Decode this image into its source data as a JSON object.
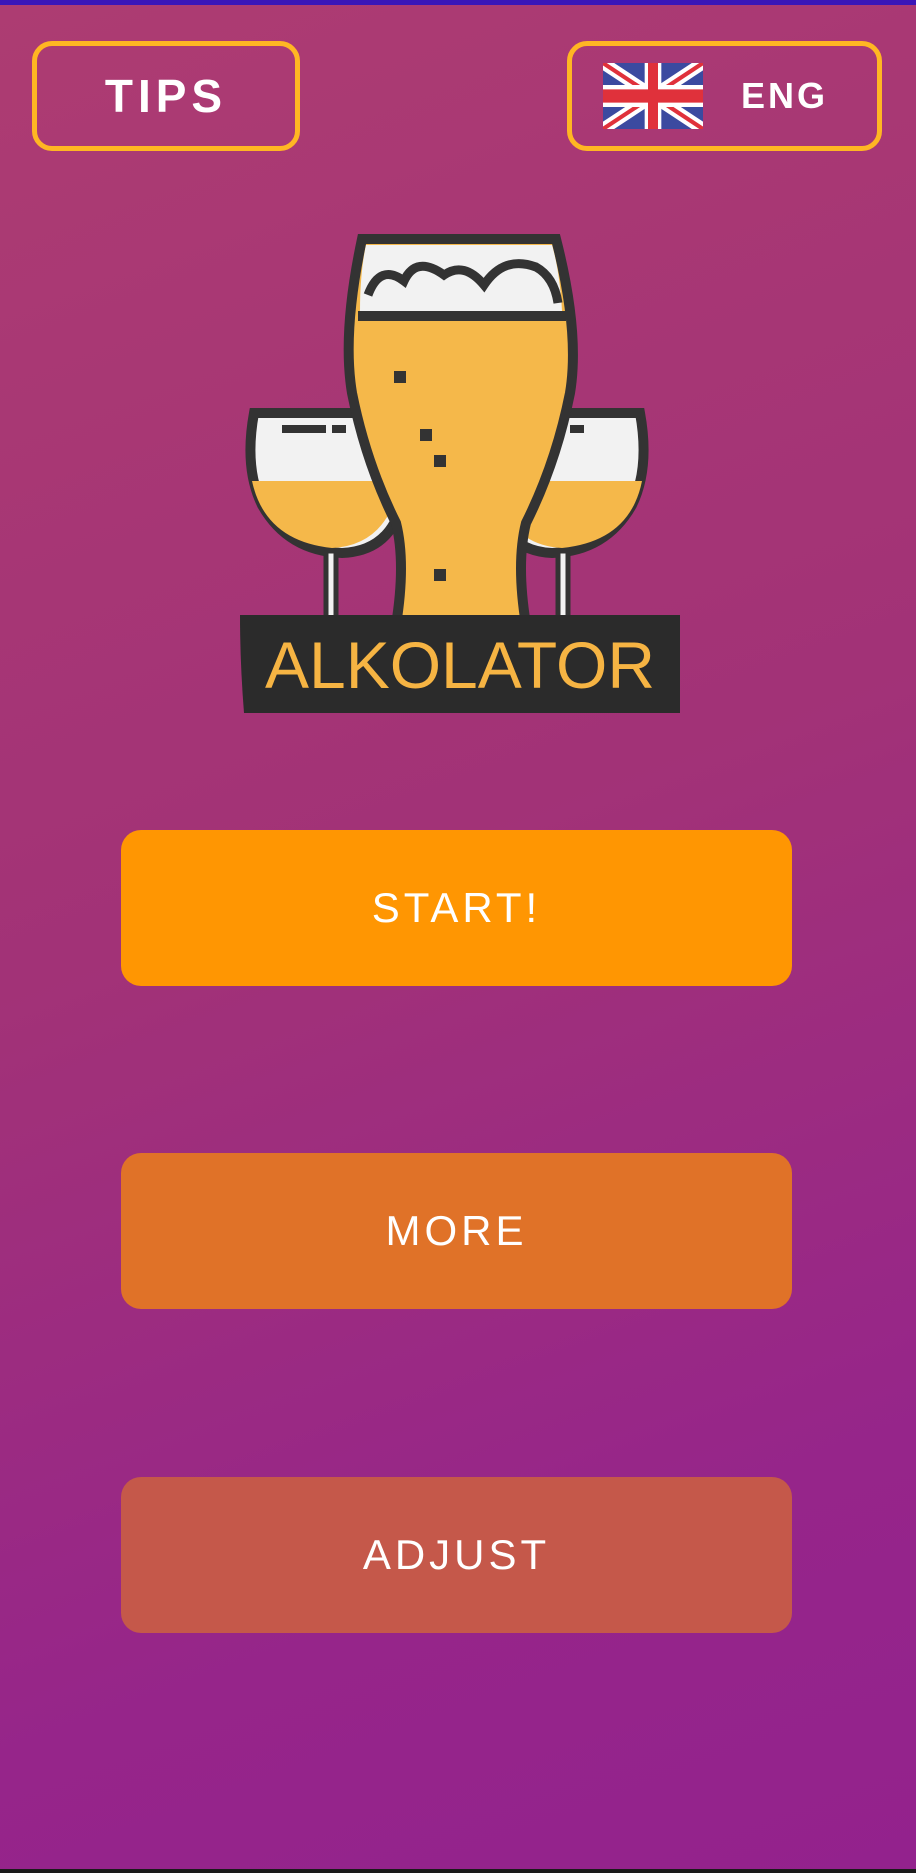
{
  "header": {
    "tips_label": "TIPS",
    "language_label": "ENG",
    "language_flag_icon": "uk-flag-icon"
  },
  "logo": {
    "text": "ALKOLATOR",
    "icon": "beer-and-wine-glasses-icon"
  },
  "buttons": {
    "start_label": "START!",
    "more_label": "MORE",
    "adjust_label": "ADJUST"
  },
  "colors": {
    "accent_border": "#ffb623",
    "start_button": "#ff9602",
    "more_button": "#e07228",
    "adjust_button": "#c5584a",
    "logo_text": "#f6b443",
    "logo_plate": "#2b2b2b"
  }
}
